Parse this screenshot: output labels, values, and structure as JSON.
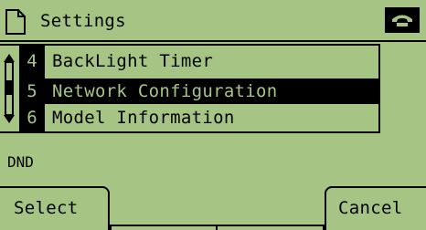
{
  "header": {
    "title": "Settings",
    "title_icon": "document-icon",
    "status_icon": "phone-handset-icon"
  },
  "menu": {
    "items": [
      {
        "number": "4",
        "label": "BackLight Timer",
        "selected": false
      },
      {
        "number": "5",
        "label": "Network Configuration",
        "selected": true
      },
      {
        "number": "6",
        "label": "Model Information",
        "selected": false
      }
    ],
    "scroll_icon": "scroll-arrows-icon"
  },
  "status_text": "DND",
  "softkeys": {
    "left": "Select",
    "right": "Cancel"
  },
  "colors": {
    "background": "#a6c584",
    "foreground": "#000000"
  }
}
